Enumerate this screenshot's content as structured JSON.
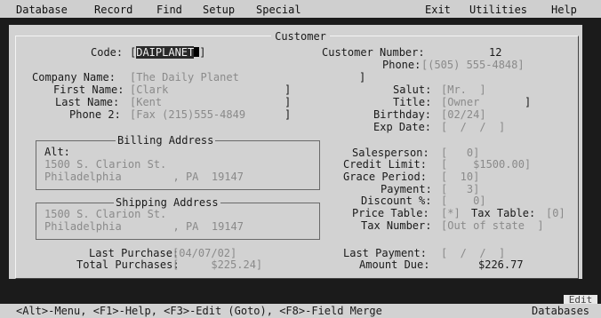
{
  "menu": {
    "left": [
      "Database",
      "Record",
      "Find",
      "Setup",
      "Special"
    ],
    "right": [
      "Exit",
      "Utilities",
      "Help"
    ]
  },
  "window": {
    "title": "Customer"
  },
  "form": {
    "code_label": "Code:",
    "code_value": "DAIPLANET",
    "customer_number_label": "Customer Number:",
    "customer_number_value": "12",
    "phone_label": "Phone:",
    "phone_value": "[(505) 555-4848]",
    "company_label": "Company Name:",
    "company_value": "[The Daily Planet",
    "company_close": "]",
    "first_name_label": "First Name:",
    "first_name_value": "[Clark",
    "first_name_close": "]",
    "last_name_label": "Last Name:",
    "last_name_value": "[Kent",
    "last_name_close": "]",
    "phone2_label": "Phone 2:",
    "phone2_value": "[Fax (215)555-4849",
    "phone2_close": "]",
    "salut_label": "Salut:",
    "salut_value": "[Mr.  ]",
    "title_label": "Title:",
    "title_value": "[Owner",
    "title_close": "]",
    "birthday_label": "Birthday:",
    "birthday_value": "[02/24]",
    "expdate_label": "Exp Date:",
    "expdate_value": "[  /  /  ]",
    "billing": {
      "title": "Billing Address",
      "alt": "Alt:",
      "street": "1500 S. Clarion St.",
      "city_state_zip": "Philadelphia        , PA  19147"
    },
    "shipping": {
      "title": "Shipping Address",
      "street": "1500 S. Clarion St.",
      "city_state_zip": "Philadelphia        , PA  19147"
    },
    "salesperson_label": "Salesperson:",
    "salesperson_value": "[   0]",
    "credit_limit_label": "Credit Limit:",
    "credit_limit_value": "[    $1500.00]",
    "grace_label": "Grace Period:",
    "grace_value": "[  10]",
    "payment_label": "Payment:",
    "payment_value": "[   3]",
    "discount_label": "Discount %:",
    "discount_value": "[    0]",
    "price_table_label": "Price Table:",
    "price_table_value": "[*]",
    "tax_table_label": "Tax Table:",
    "tax_table_value": "[0]",
    "tax_number_label": "Tax Number:",
    "tax_number_value": "[Out of state  ]",
    "last_purchase_label": "Last Purchase:",
    "last_purchase_value": "[04/07/02]",
    "total_purchases_label": "Total Purchases:",
    "total_purchases_value": "[     $225.24]",
    "last_payment_label": "Last Payment:",
    "last_payment_value": "[  /  /  ]",
    "amount_due_label": "Amount Due:",
    "amount_due_value": "$226.77"
  },
  "status": {
    "edit": "Edit",
    "hints": "<Alt>-Menu, <F1>-Help, <F3>-Edit (Goto), <F8>-Field Merge",
    "mode": "Databases"
  }
}
